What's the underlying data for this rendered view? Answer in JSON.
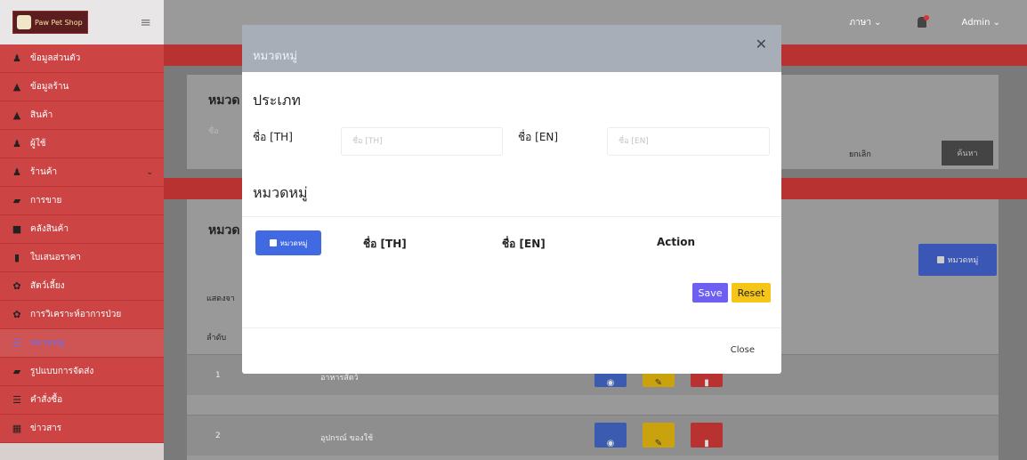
{
  "brand": {
    "name": "Paw Pet Shop"
  },
  "sidebar": {
    "items": [
      {
        "label": "ข้อมูลส่วนตัว",
        "icon": "user-icon"
      },
      {
        "label": "ข้อมูลร้าน",
        "icon": "home-icon"
      },
      {
        "label": "สินค้า",
        "icon": "home-icon"
      },
      {
        "label": "ผู้ใช้",
        "icon": "users-icon"
      },
      {
        "label": "ร้านค้า",
        "icon": "users-icon"
      },
      {
        "label": "การขาย",
        "icon": "car-icon"
      },
      {
        "label": "คลังสินค้า",
        "icon": "archive-icon"
      },
      {
        "label": "ใบเสนอราคา",
        "icon": "file-icon"
      },
      {
        "label": "สัตว์เลี้ยง",
        "icon": "paw-icon"
      },
      {
        "label": "การวิเคราะห์อาการป่วย",
        "icon": "paw-icon"
      },
      {
        "label": "หมวดหมู่",
        "icon": "database-icon"
      },
      {
        "label": "รูปแบบการจัดส่ง",
        "icon": "car-icon"
      },
      {
        "label": "คำสั่งซื้อ",
        "icon": "database-icon"
      },
      {
        "label": "ข่าวสาร",
        "icon": "news-icon"
      }
    ]
  },
  "topbar": {
    "language": "ภาษา",
    "user": "Admin"
  },
  "background": {
    "search_title": "หมวด",
    "search_placeholder": "ชื่อ",
    "cancel": "ยกเลิก",
    "search": "ค้นหา",
    "list_title": "หมวด",
    "add_category": "หมวดหมู่",
    "showing": "แสดงจา",
    "col_no": "ลำดับ",
    "rows": [
      {
        "no": "1",
        "name": "อาหารสัตว์"
      },
      {
        "no": "2",
        "name": "อุปกรณ์ ของใช้"
      }
    ]
  },
  "modal": {
    "title": "หมวดหมู่",
    "type_heading": "ประเภท",
    "name_th_label": "ชื่อ [TH]",
    "name_th_placeholder": "ชื่อ [TH]",
    "name_en_label": "ชื่อ [EN]",
    "name_en_placeholder": "ชื่อ [EN]",
    "category_heading": "หมวดหมู่",
    "add_button": "หมวดหมู่",
    "col_th": "ชื่อ [TH]",
    "col_en": "ชื่อ [EN]",
    "col_action": "Action",
    "save": "Save",
    "reset": "Reset",
    "close": "Close"
  },
  "colors": {
    "sidebar_red": "#cc4444",
    "primary": "#4169e1",
    "save": "#6d5ff2",
    "reset": "#f5c518"
  }
}
